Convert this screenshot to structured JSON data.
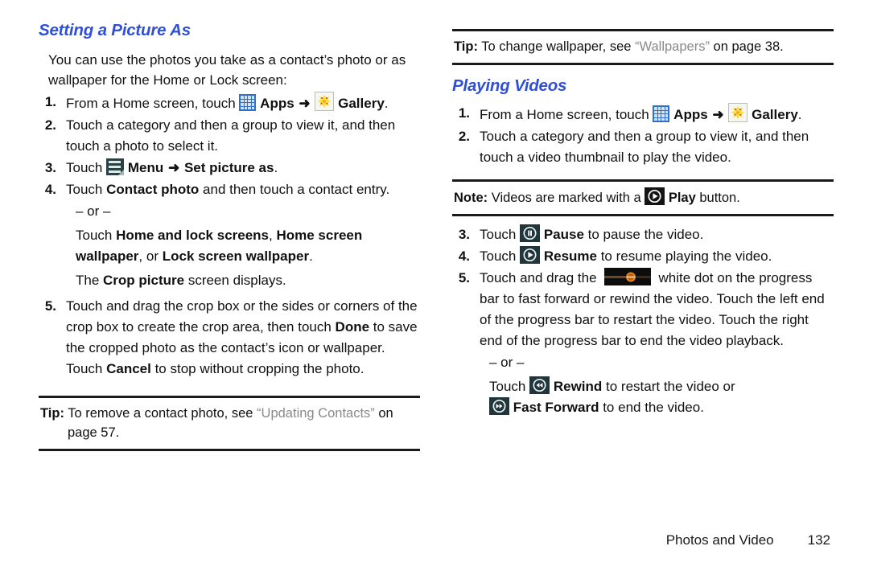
{
  "left_column": {
    "heading": "Setting a Picture As",
    "intro": "You can use the photos you take as a contact’s photo or as wallpaper for the Home or Lock screen:",
    "steps": [
      {
        "num": "1.",
        "pre": "From a Home screen, touch",
        "apps_label": "Apps",
        "arrow": "➜",
        "gallery_label": "Gallery",
        "post": "."
      },
      {
        "num": "2.",
        "text": "Touch a category and then a group to view it, and then touch a photo to select it."
      },
      {
        "num": "3.",
        "pre": "Touch",
        "menu_label": "Menu",
        "arrow": "➜",
        "action_label": "Set picture as",
        "post": "."
      },
      {
        "num": "4.",
        "pre": "Touch",
        "bold1": "Contact photo",
        "post": " and then touch a contact entry.",
        "or": "– or –",
        "alt_pre": "Touch ",
        "alt_b1": "Home and lock screens",
        "alt_sep1": ", ",
        "alt_b2": "Home screen wallpaper",
        "alt_sep2": ", or ",
        "alt_b3": "Lock screen wallpaper",
        "alt_post": ".",
        "result_pre": "The ",
        "result_bold": "Crop picture",
        "result_post": " screen displays."
      },
      {
        "num": "5.",
        "pre": "Touch and drag the crop box or the sides or corners of the crop box to create the crop area, then touch ",
        "bold1": "Done",
        "mid": " to save the cropped photo as the contact’s icon or wallpaper. Touch ",
        "bold2": "Cancel",
        "post": " to stop without cropping the photo."
      }
    ],
    "tip": {
      "label": "Tip:",
      "pre": " To remove a contact photo, see ",
      "xref": "“Updating Contacts”",
      "post": "  on page 57."
    }
  },
  "right_column": {
    "tip_wallpaper": {
      "label": "Tip:",
      "pre": " To change wallpaper, see ",
      "xref": "“Wallpapers”",
      "post": "  on page 38."
    },
    "heading": "Playing Videos",
    "steps_top": [
      {
        "num": "1.",
        "pre": "From a Home screen, touch",
        "apps_label": "Apps",
        "arrow": "➜",
        "gallery_label": "Gallery",
        "post": "."
      },
      {
        "num": "2.",
        "text": "Touch a category and then a group to view it, and then touch a video thumbnail to play the video."
      }
    ],
    "note": {
      "label": "Note:",
      "pre": " Videos are marked with a ",
      "bold": "Play",
      "post": " button."
    },
    "steps_bottom": [
      {
        "num": "3.",
        "pre": "Touch",
        "bold": "Pause",
        "post": " to pause the video.",
        "icon": "pause-icon"
      },
      {
        "num": "4.",
        "pre": "Touch",
        "bold": "Resume",
        "post": " to resume playing the video.",
        "icon": "resume-icon"
      }
    ],
    "step5": {
      "num": "5.",
      "pre": "Touch and drag the",
      "post": "white dot on the progress bar to fast forward or rewind the video. Touch the left end of the progress bar to restart the video. Touch the right end of the progress bar to end the video playback.",
      "or": "– or –",
      "alt_pre": "Touch",
      "rewind_bold": "Rewind",
      "alt_mid": " to restart the video or",
      "ff_bold": "Fast Forward",
      "alt_post": " to end the video."
    }
  },
  "footer": {
    "chapter": "Photos and Video",
    "page": "132"
  },
  "colors": {
    "heading": "#2f4fd8",
    "text": "#111111",
    "xref": "#8a8a8a",
    "apps_icon": "#2f6fd0",
    "gallery_flower": "#f5e13c",
    "menu_icon": "#2b4146",
    "media_icon": "#141414",
    "progress_dot": "#e8821e"
  }
}
